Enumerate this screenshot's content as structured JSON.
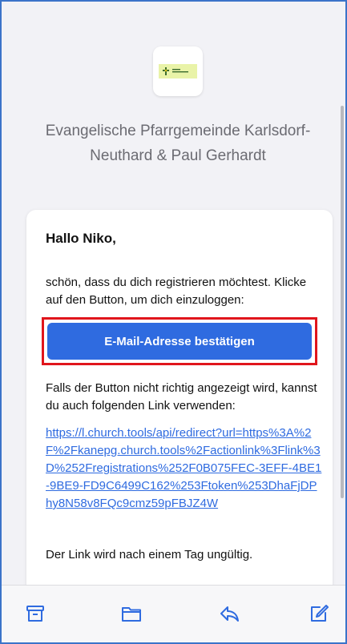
{
  "email": {
    "organization_name": "Evangelische Pfarrgemeinde Karlsdorf-Neuthard & Paul Gerhardt",
    "greeting": "Hallo Niko,",
    "intro_text": "schön, dass du dich registrieren möchtest. Klicke auf den Button, um dich einzuloggen:",
    "confirm_button_label": "E-Mail-Adresse bestätigen",
    "fallback_text": "Falls der Button nicht richtig angezeigt wird, kannst du auch folgenden Link verwenden:",
    "link_url": "https://l.church.tools/api/redirect?url=https%3A%2F%2Fkanepg.church.tools%2Factionlink%3Flink%3D%252Fregistrations%252F0B075FEC-3EFF-4BE1-9BE9-FD9C6499C162%253Ftoken%253DhaFjDPhy8N58v8FQc9cmz59pFBJZ4W",
    "expiry_text": "Der Link wird nach einem Tag ungültig."
  },
  "toolbar": {
    "icons": [
      "archive-icon",
      "folder-icon",
      "reply-icon",
      "compose-icon"
    ]
  },
  "colors": {
    "accent": "#2f6be0",
    "highlight_border": "#e0151c",
    "frame_border": "#3b74c9"
  }
}
